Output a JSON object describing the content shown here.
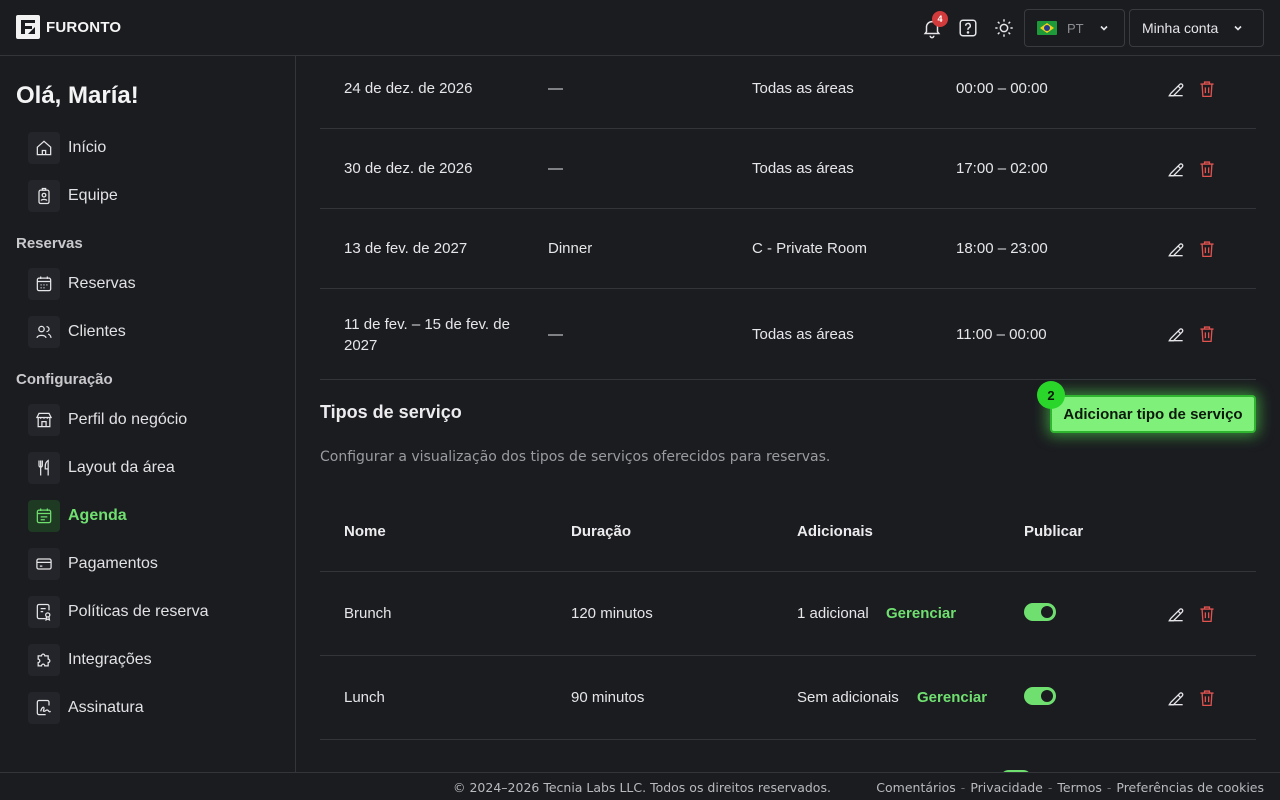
{
  "header": {
    "logo_text": "FURONTO",
    "notification_count": "4",
    "language": "PT",
    "account_label": "Minha conta"
  },
  "sidebar": {
    "greeting": "Olá, María!",
    "top_items": [
      {
        "label": "Início",
        "icon": "home-icon"
      },
      {
        "label": "Equipe",
        "icon": "badge-icon"
      }
    ],
    "sections": [
      {
        "title": "Reservas",
        "items": [
          {
            "label": "Reservas",
            "icon": "calendar-icon"
          },
          {
            "label": "Clientes",
            "icon": "users-icon"
          }
        ]
      },
      {
        "title": "Configuração",
        "items": [
          {
            "label": "Perfil do negócio",
            "icon": "store-icon"
          },
          {
            "label": "Layout da área",
            "icon": "utensils-icon"
          },
          {
            "label": "Agenda",
            "icon": "calendar-list-icon",
            "active": true
          },
          {
            "label": "Pagamentos",
            "icon": "card-icon"
          },
          {
            "label": "Políticas de reserva",
            "icon": "policy-icon"
          },
          {
            "label": "Integrações",
            "icon": "puzzle-icon"
          },
          {
            "label": "Assinatura",
            "icon": "signature-icon"
          }
        ]
      }
    ]
  },
  "exceptions": [
    {
      "date": "24 de dez. de 2026",
      "service": "—",
      "area": "Todas as áreas",
      "time": "00:00 – 00:00"
    },
    {
      "date": "30 de dez. de 2026",
      "service": "—",
      "area": "Todas as áreas",
      "time": "17:00 – 02:00"
    },
    {
      "date": "13 de fev. de 2027",
      "service": "Dinner",
      "area": "C - Private Room",
      "time": "18:00 – 23:00"
    },
    {
      "date_line1": "11 de fev. – 15 de fev. de",
      "date_line2": "2027",
      "service": "—",
      "area": "Todas as áreas",
      "time": "11:00 – 00:00"
    }
  ],
  "service_types": {
    "title": "Tipos de serviço",
    "description": "Configurar a visualização dos tipos de serviços oferecidos para reservas.",
    "add_button": "Adicionar tipo de serviço",
    "step_badge": "2",
    "columns": [
      "Nome",
      "Duração",
      "Adicionais",
      "Publicar"
    ],
    "rows": [
      {
        "name": "Brunch",
        "duration": "120 minutos",
        "addons": "1 adicional",
        "manage": "Gerenciar",
        "published": true
      },
      {
        "name": "Lunch",
        "duration": "90 minutos",
        "addons": "Sem adicionais",
        "manage": "Gerenciar",
        "published": true
      }
    ]
  },
  "footer": {
    "copyright": "© 2024–2026 Tecnia Labs LLC. Todos os direitos reservados.",
    "links": [
      "Comentários",
      "Privacidade",
      "Termos",
      "Preferências de cookies"
    ]
  },
  "colors": {
    "accent": "#6fe070",
    "background": "#1b1c20",
    "danger": "#e0534f"
  }
}
